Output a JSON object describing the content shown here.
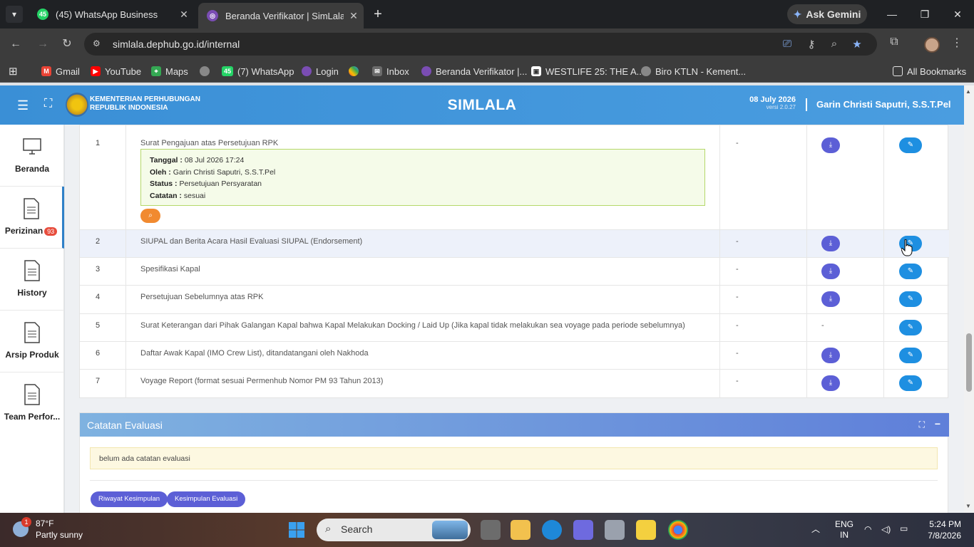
{
  "browser": {
    "tabs": [
      {
        "label": "(45) WhatsApp Business",
        "favicon_badge": "45",
        "active": false
      },
      {
        "label": "Beranda Verifikator | SimLala",
        "active": true
      }
    ],
    "gemini_label": "Ask Gemini",
    "url": "simlala.dephub.go.id/internal",
    "bookmarks": [
      {
        "label": "Gmail",
        "icon": "gmail-icon"
      },
      {
        "label": "YouTube",
        "icon": "youtube-icon"
      },
      {
        "label": "Maps",
        "icon": "maps-icon"
      },
      {
        "label": "",
        "icon": "globe-icon"
      },
      {
        "label": "(7) WhatsApp",
        "icon": "whatsapp-icon",
        "badge": "45"
      },
      {
        "label": "Login",
        "icon": "simlala-icon"
      },
      {
        "label": "",
        "icon": "photos-icon"
      },
      {
        "label": "Inbox",
        "icon": "inbox-icon"
      },
      {
        "label": "Beranda Verifikator |...",
        "icon": "simlala-icon"
      },
      {
        "label": "WESTLIFE 25: THE A...",
        "icon": "page-icon"
      },
      {
        "label": "Biro KTLN - Kement...",
        "icon": "globe-icon"
      }
    ],
    "all_bookmarks": "All Bookmarks"
  },
  "app": {
    "ministry_line1": "KEMENTERIAN PERHUBUNGAN",
    "ministry_line2": "REPUBLIK INDONESIA",
    "brand": "SIMLALA",
    "date": "08 July 2026",
    "version": "versi 2.0.27",
    "user": "Garin Christi Saputri, S.S.T.Pel"
  },
  "sidebar": {
    "items": [
      {
        "label": "Beranda",
        "icon": "monitor-icon"
      },
      {
        "label": "Perizinan",
        "icon": "document-icon",
        "badge": "93"
      },
      {
        "label": "History",
        "icon": "document-icon"
      },
      {
        "label": "Arsip Produk",
        "icon": "document-icon"
      },
      {
        "label": "Team Perfor...",
        "icon": "document-icon"
      }
    ]
  },
  "table": {
    "rows": [
      {
        "no": "1",
        "doc": "Surat Pengajuan atas Persetujuan RPK",
        "status": "-",
        "download": true
      },
      {
        "no": "2",
        "doc": "SIUPAL dan Berita Acara Hasil Evaluasi SIUPAL (Endorsement)",
        "status": "-",
        "download": true
      },
      {
        "no": "3",
        "doc": "Spesifikasi Kapal",
        "status": "-",
        "download": true
      },
      {
        "no": "4",
        "doc": "Persetujuan Sebelumnya atas RPK",
        "status": "-",
        "download": true
      },
      {
        "no": "5",
        "doc": "Surat Keterangan dari Pihak Galangan Kapal bahwa Kapal Melakukan Docking / Laid Up (Jika kapal tidak melakukan sea voyage pada periode sebelumnya)",
        "status": "-",
        "download": false,
        "download_text": "-"
      },
      {
        "no": "6",
        "doc": "Daftar Awak Kapal (IMO Crew List), ditandatangani oleh Nakhoda",
        "status": "-",
        "download": true
      },
      {
        "no": "7",
        "doc": "Voyage Report (format sesuai Permenhub Nomor PM 93 Tahun 2013)",
        "status": "-",
        "download": true
      }
    ],
    "note": {
      "tanggal_label": "Tanggal :",
      "tanggal": "08 Jul 2026 17:24",
      "oleh_label": "Oleh :",
      "oleh": "Garin Christi Saputri, S.S.T.Pel",
      "status_label": "Status :",
      "status": "Persetujuan Persyaratan",
      "catatan_label": "Catatan :",
      "catatan": "sesuai"
    }
  },
  "evaluasi": {
    "title": "Catatan Evaluasi",
    "note": "belum ada catatan evaluasi",
    "btn_riwayat": "Riwayat Kesimpulan",
    "btn_kesimpulan": "Kesimpulan Evaluasi"
  },
  "taskbar": {
    "temp": "87°F",
    "weather": "Partly sunny",
    "weather_badge": "1",
    "search": "Search",
    "lang1": "ENG",
    "lang2": "IN",
    "time": "5:24 PM",
    "date": "7/8/2026"
  }
}
